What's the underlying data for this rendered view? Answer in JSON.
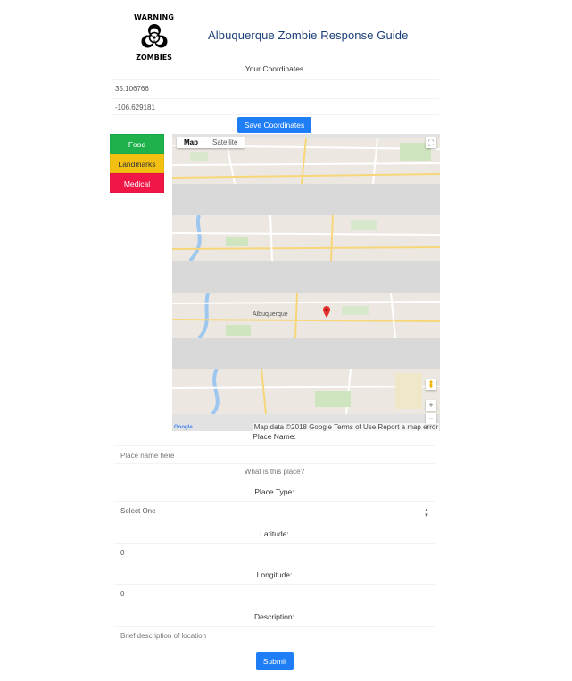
{
  "header": {
    "logo_top": "WARNING",
    "logo_bottom": "ZOMBIES",
    "title": "Albuquerque Zombie Response Guide"
  },
  "coordinates": {
    "title": "Your Coordinates",
    "latitude": "35.106766",
    "longitude": "-106.629181",
    "save_label": "Save Coordinates"
  },
  "categories": [
    {
      "label": "Food",
      "color": "#1fb14c"
    },
    {
      "label": "Landmarks",
      "color": "#f3c012"
    },
    {
      "label": "Medical",
      "color": "#f01646"
    }
  ],
  "map": {
    "type_map": "Map",
    "type_satellite": "Satellite",
    "city_label": "Albuquerque",
    "google": "Google",
    "footer": "Map data ©2018 Google  Terms of Use  Report a map error",
    "zoom_in": "+",
    "zoom_out": "−",
    "fullscreen": "⛶"
  },
  "form": {
    "place_name_label": "Place Name:",
    "place_name_placeholder": "Place name here",
    "place_name_hint": "What is this place?",
    "place_type_label": "Place Type:",
    "place_type_selected": "Select One",
    "latitude_label": "Latitude:",
    "latitude_value": "0",
    "longitude_label": "Longitude:",
    "longitude_value": "0",
    "description_label": "Description:",
    "description_placeholder": "Brief description of location",
    "submit_label": "Submit"
  }
}
